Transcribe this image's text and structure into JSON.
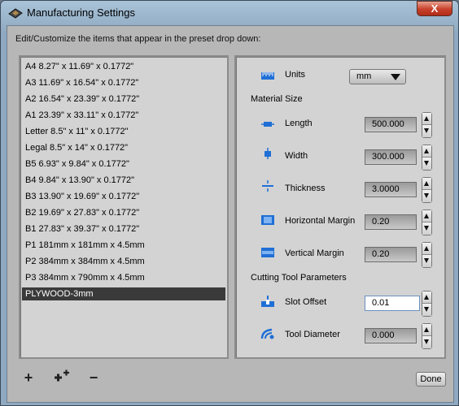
{
  "window": {
    "title": "Manufacturing Settings",
    "close_label": "X"
  },
  "instruction": "Edit/Customize the items that appear in the preset drop down:",
  "presets": [
    "A4 8.27\" x 11.69\" x 0.1772\"",
    "A3 11.69\" x 16.54\" x 0.1772\"",
    "A2 16.54\" x 23.39\" x 0.1772\"",
    "A1 23.39\" x 33.11\" x 0.1772\"",
    "Letter 8.5\" x 11\" x 0.1772\"",
    "Legal 8.5\" x 14\" x 0.1772\"",
    "B5 6.93\" x 9.84\" x 0.1772\"",
    "B4 9.84\" x 13.90\" x 0.1772\"",
    "B3 13.90\" x 19.69\" x 0.1772\"",
    "B2 19.69\" x 27.83\" x 0.1772\"",
    "B1 27.83\" x 39.37\" x 0.1772\"",
    "P1 181mm x 181mm x 4.5mm",
    "P2 384mm x 384mm x 4.5mm",
    "P3 384mm x 790mm x 4.5mm",
    "PLYWOOD-3mm"
  ],
  "selected_preset_index": 14,
  "settings": {
    "units_label": "Units",
    "units_value": "mm",
    "material_size_heading": "Material Size",
    "length_label": "Length",
    "length_value": "500.000",
    "width_label": "Width",
    "width_value": "300.000",
    "thickness_label": "Thickness",
    "thickness_value": "3.0000",
    "hmargin_label": "Horizontal Margin",
    "hmargin_value": "0.20",
    "vmargin_label": "Vertical Margin",
    "vmargin_value": "0.20",
    "cutting_heading": "Cutting Tool Parameters",
    "slot_label": "Slot Offset",
    "slot_value": "0.01",
    "tool_label": "Tool Diameter",
    "tool_value": "0.000"
  },
  "buttons": {
    "add": "+",
    "add_multi": "++",
    "remove": "−",
    "done": "Done"
  },
  "icons": {
    "app": "laser-cutter-icon",
    "units": "ruler-icon",
    "length": "length-icon",
    "width": "width-icon",
    "thickness": "thickness-icon",
    "hmargin": "horizontal-margin-icon",
    "vmargin": "vertical-margin-icon",
    "slot": "slot-offset-icon",
    "tool": "tool-diameter-icon"
  },
  "colors": {
    "icon_blue": "#1f6fd6",
    "selection": "#3a3a3a",
    "close_red": "#c7402a"
  }
}
